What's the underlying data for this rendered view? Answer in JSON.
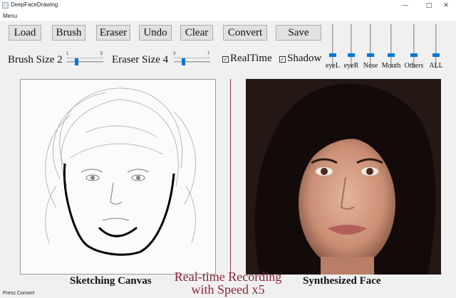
{
  "window": {
    "title": "DeepFaceDrawing",
    "minimize": "—",
    "maximize": "□",
    "close": "✕"
  },
  "menu": {
    "label": "Menu"
  },
  "toolbar": {
    "load": "Load",
    "brush": "Brush",
    "eraser": "Eraser",
    "undo": "Undo",
    "clear": "Clear",
    "convert": "Convert",
    "save": "Save"
  },
  "brush": {
    "label": "Brush Size 2",
    "min": "1",
    "max": "5",
    "value": 2
  },
  "eraser": {
    "label": "Eraser Size 4",
    "min": "3",
    "max": "7",
    "value": 4
  },
  "realtime": {
    "label": "RealTime",
    "checked": true,
    "mark": "✓"
  },
  "shadow": {
    "label": "Shadow",
    "checked": true,
    "mark": "✓"
  },
  "weights": [
    {
      "label": "eyeL",
      "level": 0.5
    },
    {
      "label": "eyeR",
      "level": 0.5
    },
    {
      "label": "Nose",
      "level": 0.5
    },
    {
      "label": "Mouth",
      "level": 0.5
    },
    {
      "label": "Others",
      "level": 0.5
    },
    {
      "label": "ALL",
      "level": 0.5
    }
  ],
  "captions": {
    "left": "Sketching Canvas",
    "right": "Synthesized Face"
  },
  "overlay": {
    "line1": "Real-time Recording",
    "line2": "with Speed x5"
  },
  "status": "Press Convert",
  "colors": {
    "accent": "#0078d7",
    "overlay_text": "#8a2436"
  }
}
